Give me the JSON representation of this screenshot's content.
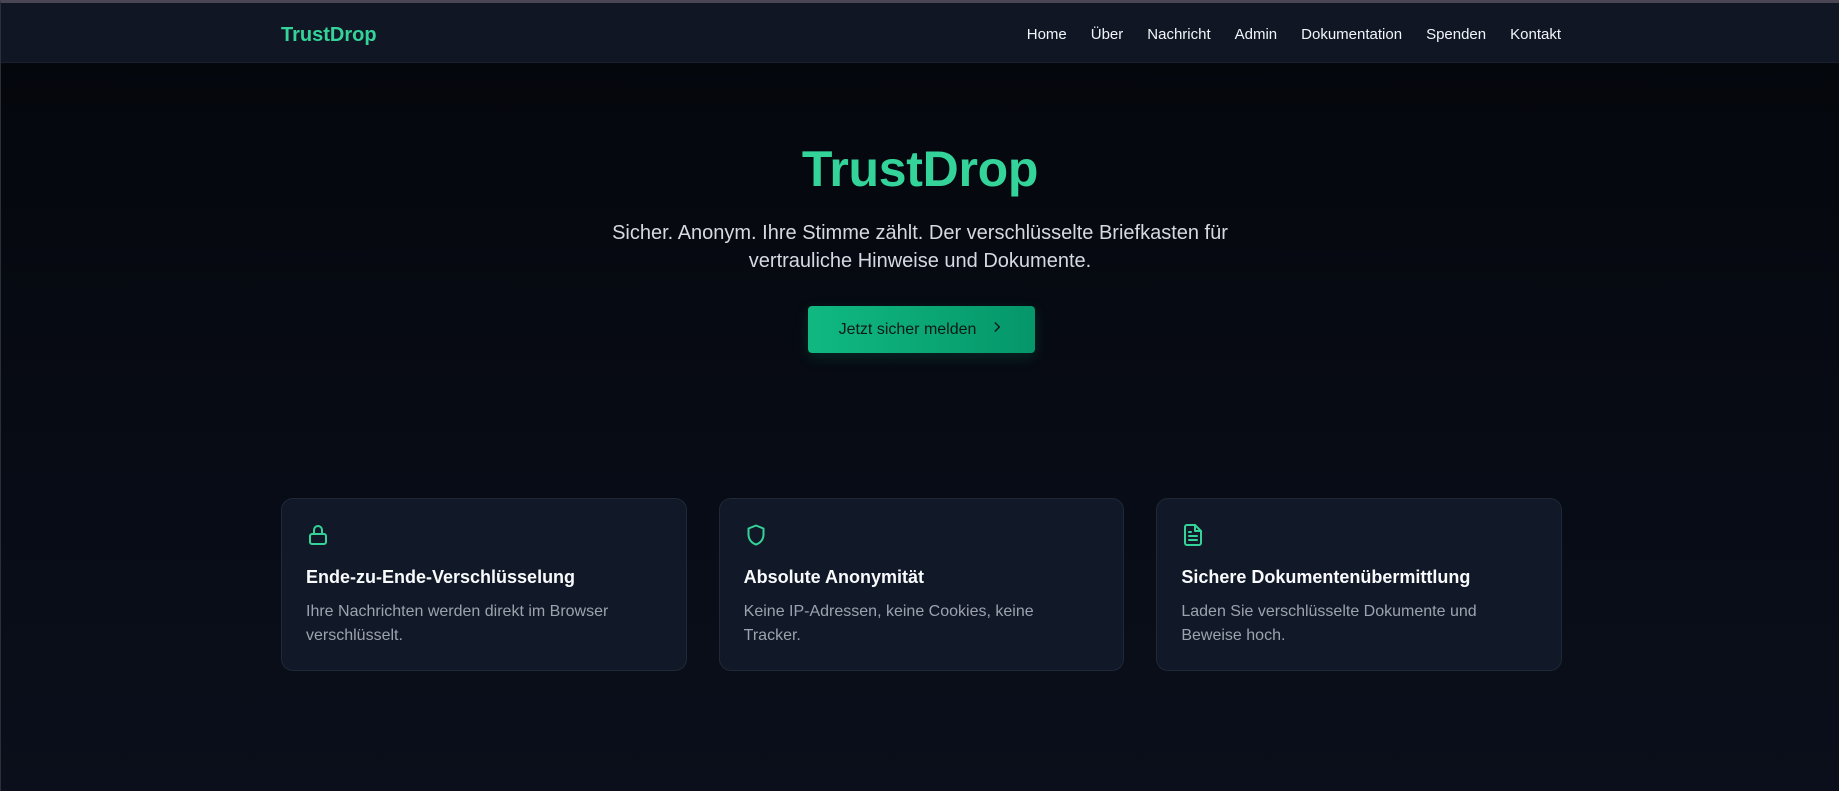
{
  "colors": {
    "accent": "#34d399",
    "button_start": "#10b981",
    "button_end": "#059669",
    "background": "#05070d",
    "card": "#111827",
    "nav": "#101624"
  },
  "navbar": {
    "brand": "TrustDrop",
    "links": [
      {
        "label": "Home"
      },
      {
        "label": "Über"
      },
      {
        "label": "Nachricht"
      },
      {
        "label": "Admin"
      },
      {
        "label": "Dokumentation"
      },
      {
        "label": "Spenden"
      },
      {
        "label": "Kontakt"
      }
    ]
  },
  "hero": {
    "title": "TrustDrop",
    "subtitle": "Sicher. Anonym. Ihre Stimme zählt. Der verschlüsselte Briefkasten für vertrauliche Hinweise und Dokumente.",
    "cta_label": "Jetzt sicher melden",
    "cta_icon": "chevron-right-icon"
  },
  "features": [
    {
      "icon": "lock-icon",
      "title": "Ende-zu-Ende-Verschlüsselung",
      "description": "Ihre Nachrichten werden direkt im Browser verschlüsselt."
    },
    {
      "icon": "shield-icon",
      "title": "Absolute Anonymität",
      "description": "Keine IP-Adressen, keine Cookies, keine Tracker."
    },
    {
      "icon": "file-text-icon",
      "title": "Sichere Dokumentenübermittlung",
      "description": "Laden Sie verschlüsselte Dokumente und Beweise hoch."
    }
  ]
}
